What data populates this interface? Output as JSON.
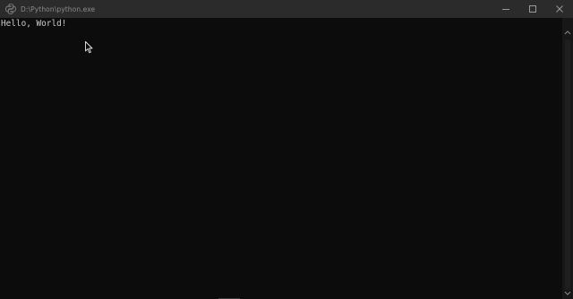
{
  "window": {
    "title": "D:\\Python\\python.exe",
    "app_icon": "python-icon",
    "background": "#0c0c0c",
    "titlebar_color": "#2b2b2b",
    "caption_buttons": [
      "minimize-icon",
      "maximize-icon",
      "close-icon"
    ]
  },
  "console": {
    "output": "Hello, World!",
    "text_color": "#cccccc"
  },
  "scrollbar": {
    "up_icon": "chevron-up-icon",
    "down_icon": "chevron-down-icon"
  }
}
